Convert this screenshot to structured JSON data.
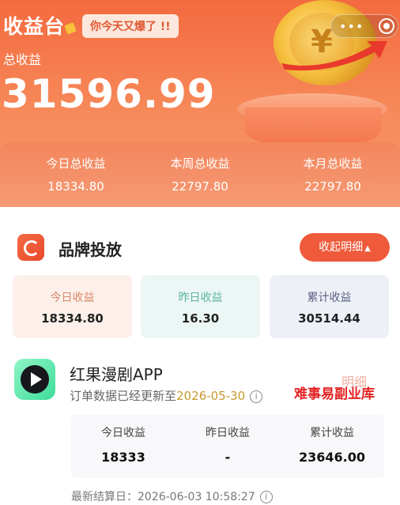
{
  "header": {
    "title": "收益台",
    "slogan": "你今天又爆了 !!",
    "total_label": "总收益",
    "total_value": "31596.99",
    "coin_symbol": "¥",
    "stats": [
      {
        "label": "今日总收益",
        "value": "18334.80"
      },
      {
        "label": "本周总收益",
        "value": "22797.80"
      },
      {
        "label": "本月总收益",
        "value": "22797.80"
      }
    ],
    "more_icon": "•••"
  },
  "brand": {
    "title": "品牌投放",
    "collapse_label": "收起明细",
    "collapse_icon": "▲",
    "summary": [
      {
        "label": "今日收益",
        "value": "18334.80"
      },
      {
        "label": "昨日收益",
        "value": "16.30"
      },
      {
        "label": "累计收益",
        "value": "30514.44"
      }
    ]
  },
  "app": {
    "name": "红果漫剧APP",
    "update_prefix": "订单数据已经更新至",
    "update_date": "2026-05-30",
    "detail_label": "明细",
    "watermark": "难事易副业库",
    "info_glyph": "i",
    "stats": [
      {
        "label": "今日收益",
        "value": "18333"
      },
      {
        "label": "昨日收益",
        "value": "-"
      },
      {
        "label": "累计收益",
        "value": "23646.00"
      }
    ],
    "settle_label": "最新结算日：",
    "settle_time": "2026-06-03 10:58:27"
  },
  "colors": {
    "accent": "#ee5a3a",
    "header_top": "#f46a3f",
    "date_highlight": "#c79a2e"
  }
}
